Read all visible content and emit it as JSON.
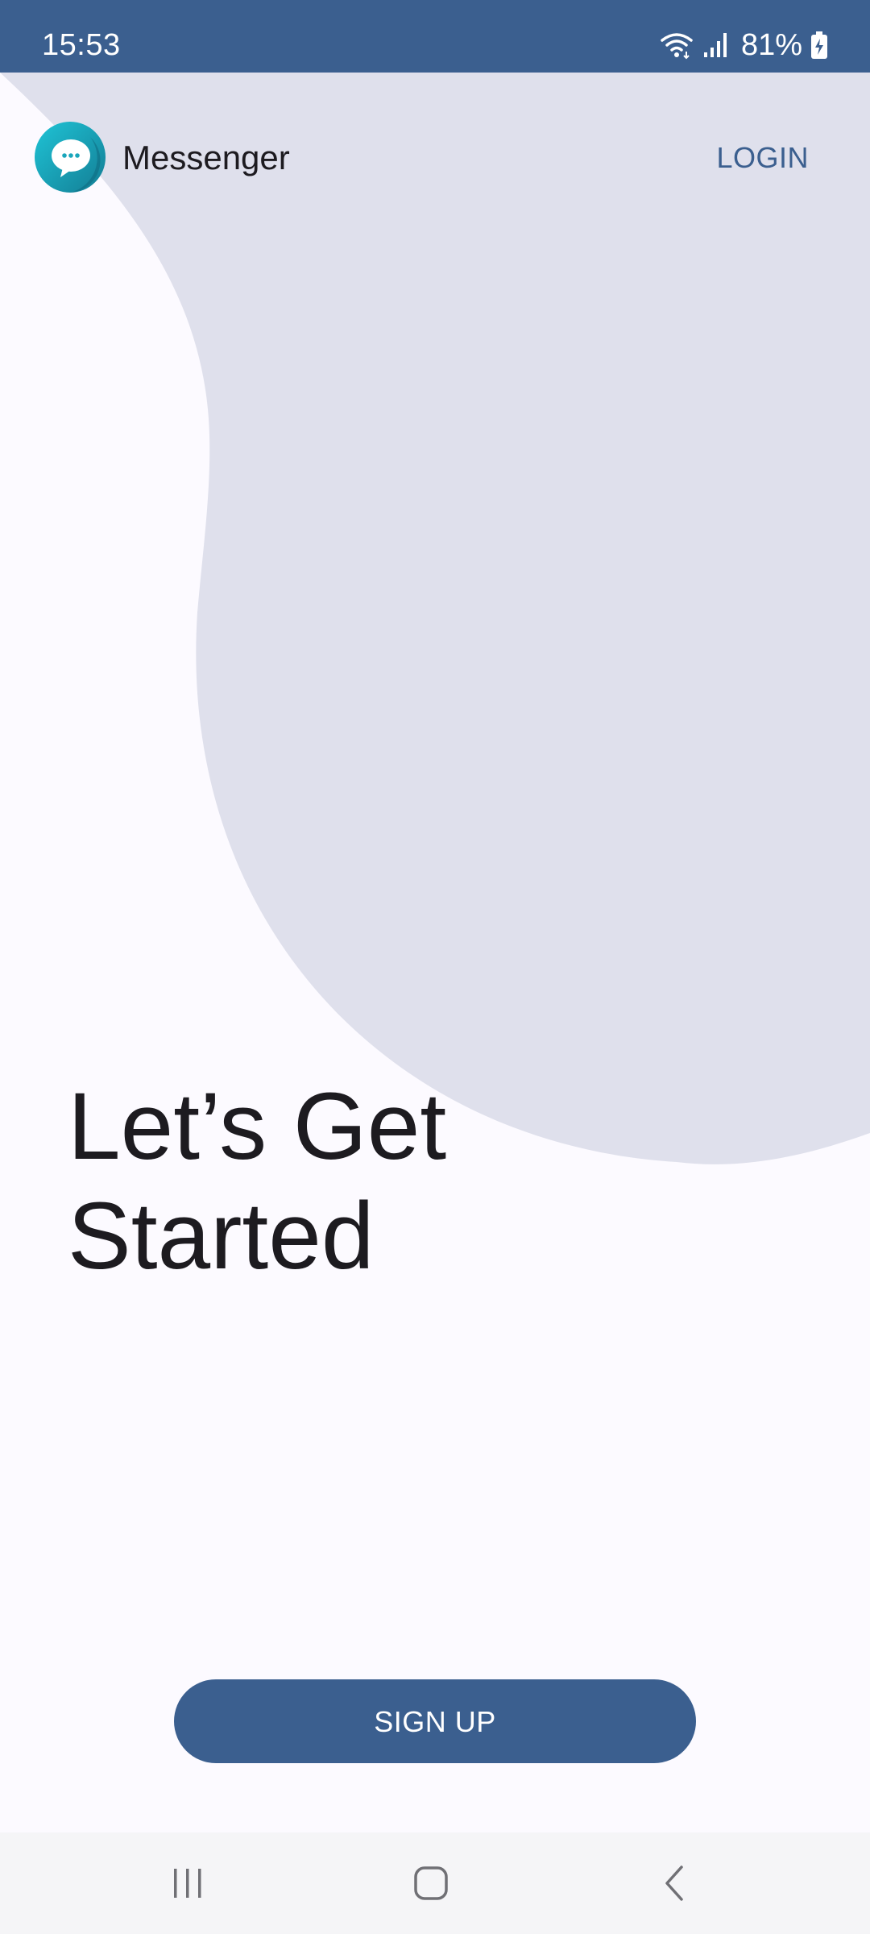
{
  "status_bar": {
    "time": "15:53",
    "battery": "81%",
    "icons": [
      "wifi-icon",
      "signal-icon",
      "battery-charging-icon"
    ]
  },
  "app_bar": {
    "app_name": "Messenger",
    "logo_icon": "chat-bubble-logo-icon",
    "login_label": "LOGIN"
  },
  "hero": {
    "headline_line1": "Let’s Get",
    "headline_line2": "Started"
  },
  "actions": {
    "signup_label": "SIGN UP"
  },
  "nav_bar": {
    "icons": [
      "recent-apps-icon",
      "home-icon",
      "back-icon"
    ]
  },
  "colors": {
    "primary": "#3b5f8f",
    "background": "#fcfaff",
    "blob": "#dfe0ec",
    "text": "#1d1b20"
  }
}
